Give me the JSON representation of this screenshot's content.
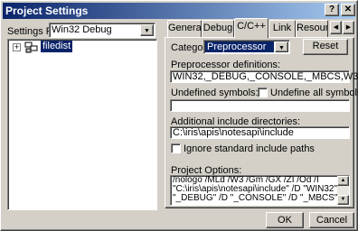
{
  "window": {
    "title": "Project Settings"
  },
  "left": {
    "settings_for_label": "Settings For:",
    "settings_for_value": "Win32 Debug",
    "tree": [
      {
        "label": "filedist"
      }
    ]
  },
  "tabs": [
    {
      "label": "General"
    },
    {
      "label": "Debug"
    },
    {
      "label": "C/C++"
    },
    {
      "label": "Link"
    },
    {
      "label": "Resourc"
    }
  ],
  "panel": {
    "category_label": "Category:",
    "category_value": "Preprocessor",
    "reset_label": "Reset",
    "preproc_label": "Preprocessor definitions:",
    "preproc_value": "WIN32,_DEBUG,_CONSOLE,_MBCS,W32",
    "undefined_label": "Undefined symbols:",
    "undefined_all_label": "Undefine all symbols",
    "undefined_value": "",
    "include_label": "Additional include directories:",
    "include_value": "C:\\iris\\apis\\notesapi\\include",
    "ignore_label": "Ignore standard include paths",
    "options_label": "Project Options:",
    "options_lines": [
      "/nologo /MLd /W3 /Gm /GX /ZI /Od /I",
      "\"C:\\iris\\apis\\notesapi\\include\" /D \"WIN32\" /D",
      "\"_DEBUG\" /D \"_CONSOLE\" /D \"_MBCS\" /D \"W32\""
    ]
  },
  "buttons": {
    "ok": "OK",
    "cancel": "Cancel"
  },
  "colors": {
    "title_start": "#0a246a",
    "title_end": "#a6caf0",
    "selection": "#0a246a"
  }
}
